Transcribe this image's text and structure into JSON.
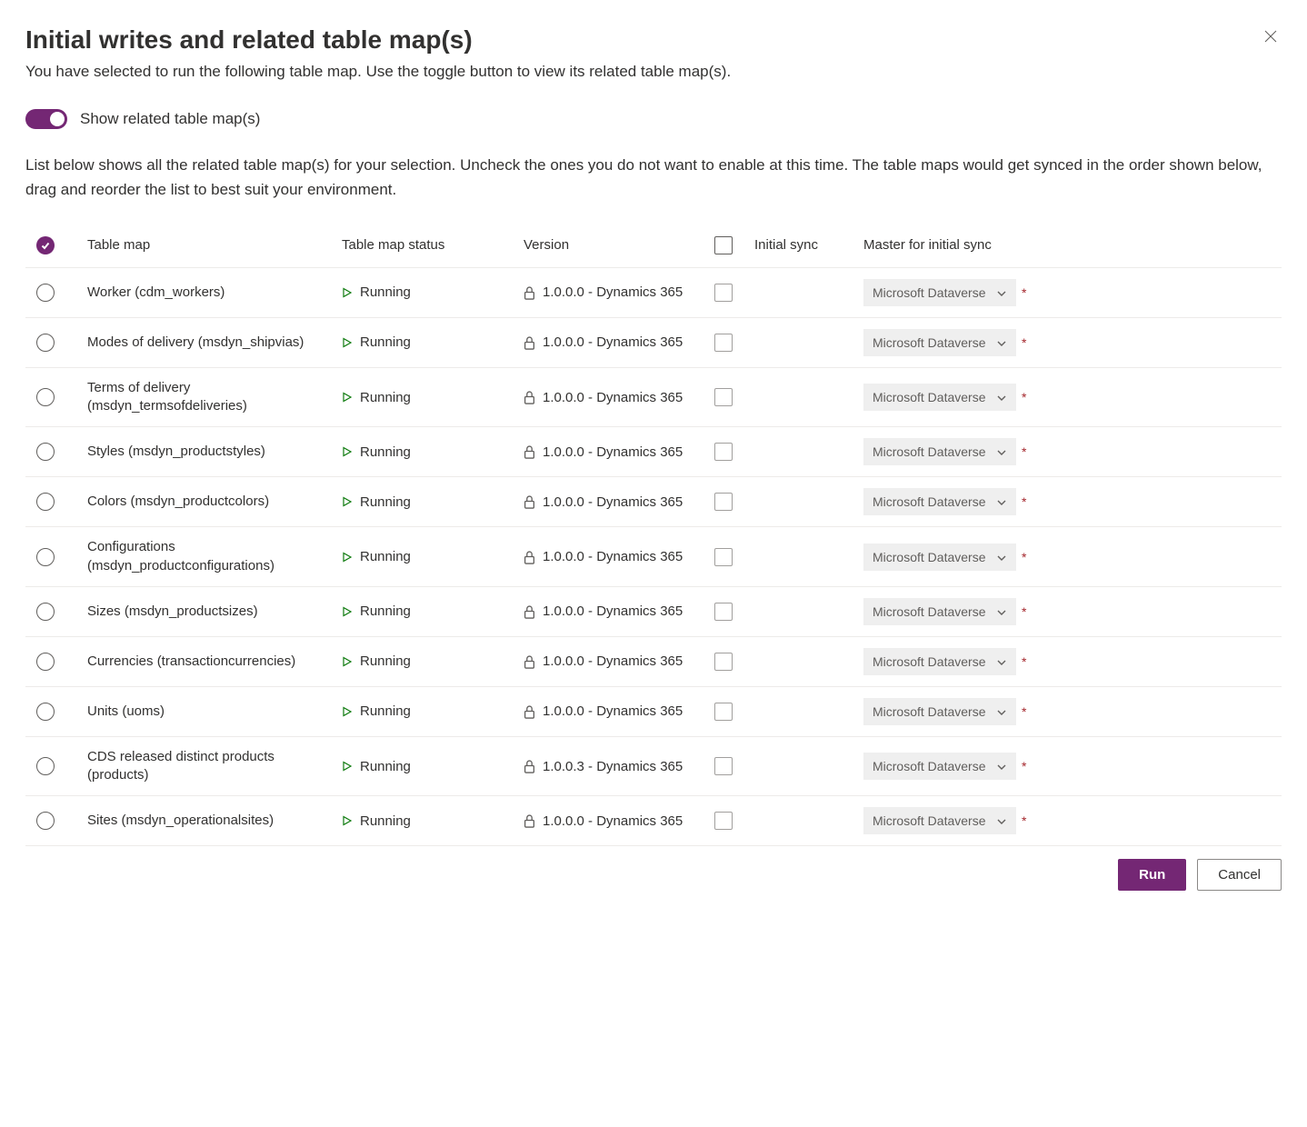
{
  "header": {
    "title": "Initial writes and related table map(s)",
    "subtitle": "You have selected to run the following table map. Use the toggle button to view its related table map(s)."
  },
  "toggle": {
    "label": "Show related table map(s)"
  },
  "instruction": "List below shows all the related table map(s) for your selection. Uncheck the ones you do not want to enable at this time. The table maps would get synced in the order shown below, drag and reorder the list to best suit your environment.",
  "columns": {
    "map": "Table map",
    "status": "Table map status",
    "version": "Version",
    "sync": "Initial sync",
    "master": "Master for initial sync"
  },
  "rows": [
    {
      "name": "Worker (cdm_workers)",
      "status": "Running",
      "version": "1.0.0.0 - Dynamics 365",
      "master": "Microsoft Dataverse"
    },
    {
      "name": "Modes of delivery (msdyn_shipvias)",
      "status": "Running",
      "version": "1.0.0.0 - Dynamics 365",
      "master": "Microsoft Dataverse"
    },
    {
      "name": "Terms of delivery (msdyn_termsofdeliveries)",
      "status": "Running",
      "version": "1.0.0.0 - Dynamics 365",
      "master": "Microsoft Dataverse"
    },
    {
      "name": "Styles (msdyn_productstyles)",
      "status": "Running",
      "version": "1.0.0.0 - Dynamics 365",
      "master": "Microsoft Dataverse"
    },
    {
      "name": "Colors (msdyn_productcolors)",
      "status": "Running",
      "version": "1.0.0.0 - Dynamics 365",
      "master": "Microsoft Dataverse"
    },
    {
      "name": "Configurations (msdyn_productconfigurations)",
      "status": "Running",
      "version": "1.0.0.0 - Dynamics 365",
      "master": "Microsoft Dataverse"
    },
    {
      "name": "Sizes (msdyn_productsizes)",
      "status": "Running",
      "version": "1.0.0.0 - Dynamics 365",
      "master": "Microsoft Dataverse"
    },
    {
      "name": "Currencies (transactioncurrencies)",
      "status": "Running",
      "version": "1.0.0.0 - Dynamics 365",
      "master": "Microsoft Dataverse"
    },
    {
      "name": "Units (uoms)",
      "status": "Running",
      "version": "1.0.0.0 - Dynamics 365",
      "master": "Microsoft Dataverse"
    },
    {
      "name": "CDS released distinct products (products)",
      "status": "Running",
      "version": "1.0.0.3 - Dynamics 365",
      "master": "Microsoft Dataverse"
    },
    {
      "name": "Sites (msdyn_operationalsites)",
      "status": "Running",
      "version": "1.0.0.0 - Dynamics 365",
      "master": "Microsoft Dataverse"
    }
  ],
  "buttons": {
    "run": "Run",
    "cancel": "Cancel"
  },
  "required_marker": "*"
}
